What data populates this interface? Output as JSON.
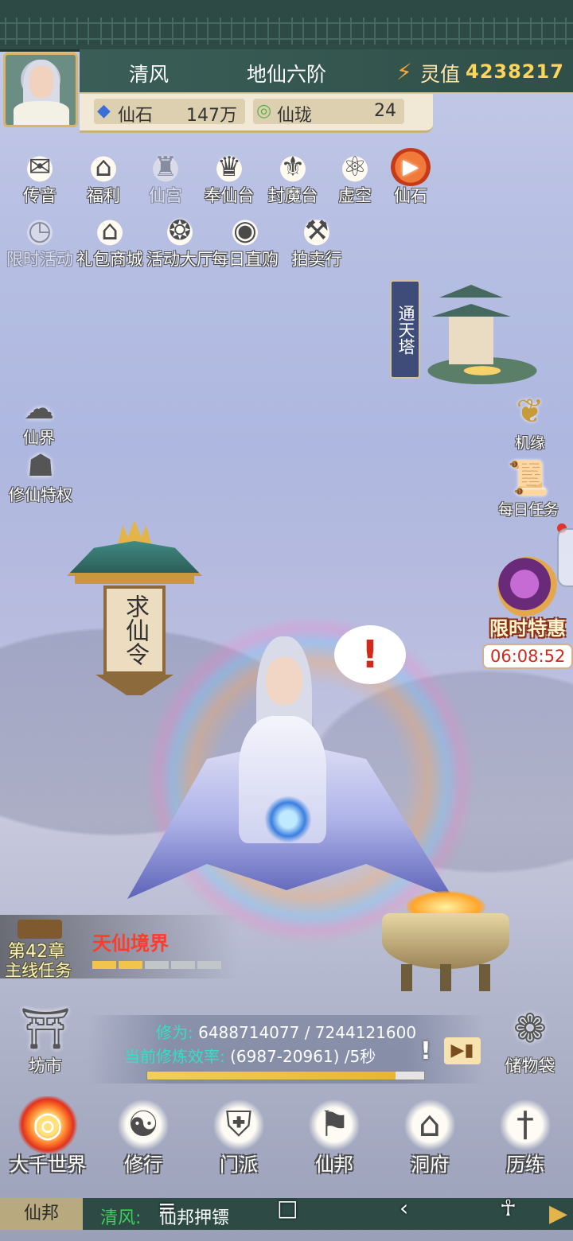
{
  "header": {
    "player_name": "清风",
    "rank": "地仙六阶",
    "power_label": "灵值",
    "power_value": "4238217",
    "currencies": [
      {
        "icon": "gem-icon",
        "label": "仙石",
        "value": "147万"
      },
      {
        "icon": "jade-ring-icon",
        "label": "仙珑",
        "value": "24"
      }
    ]
  },
  "top_icons": [
    {
      "label": "传音",
      "icon": "envelope-icon",
      "enabled": true
    },
    {
      "label": "福利",
      "icon": "gift-box-icon",
      "enabled": true
    },
    {
      "label": "仙宫",
      "icon": "palace-icon",
      "enabled": false
    },
    {
      "label": "奉仙台",
      "icon": "altar-icon",
      "enabled": true
    },
    {
      "label": "封魔台",
      "icon": "seal-icon",
      "enabled": true
    },
    {
      "label": "虚空",
      "icon": "atom-icon",
      "enabled": true
    },
    {
      "label": "仙石",
      "icon": "play-icon",
      "enabled": true
    },
    {
      "label": "限时活动",
      "icon": "timer-icon",
      "enabled": false
    },
    {
      "label": "礼包商城",
      "icon": "shop-icon",
      "enabled": true
    },
    {
      "label": "活动大厅",
      "icon": "hall-icon",
      "enabled": true
    },
    {
      "label": "每日直购",
      "icon": "coin-icon",
      "enabled": true
    },
    {
      "label": "拍卖行",
      "icon": "gavel-icon",
      "enabled": true
    }
  ],
  "left_icons": [
    {
      "label": "仙界",
      "icon": "cloud-icon"
    },
    {
      "label": "修仙特权",
      "icon": "turtle-icon"
    }
  ],
  "tower": {
    "label": "通天塔"
  },
  "right_icons": [
    {
      "label": "机缘",
      "icon": "fortune-bag-icon"
    },
    {
      "label": "每日任务",
      "icon": "scroll-icon"
    }
  ],
  "limited_offer": {
    "label": "限时特惠",
    "timer": "06:08:52"
  },
  "lantern": {
    "text": "求仙令"
  },
  "quest": {
    "chapter": "第42章",
    "type": "主线任务",
    "realm": "天仙境界",
    "progress_segments": [
      1,
      1,
      0,
      0,
      0
    ]
  },
  "cultivation": {
    "label_xiuwei": "修为:",
    "xiuwei": "6488714077 / 7244121600",
    "label_rate": "当前修炼效率:",
    "rate": "(6987-20961) /5秒",
    "progress": 0.8957,
    "left_button": "坊市",
    "right_button": "储物袋"
  },
  "nav": [
    {
      "label": "大千世界",
      "icon": "vortex-icon",
      "active": true
    },
    {
      "label": "修行",
      "icon": "yin-yang-icon",
      "active": false
    },
    {
      "label": "门派",
      "icon": "shield-icon",
      "active": false
    },
    {
      "label": "仙邦",
      "icon": "banner-icon",
      "active": false
    },
    {
      "label": "洞府",
      "icon": "pavilion-icon",
      "active": false
    },
    {
      "label": "历练",
      "icon": "sword-icon",
      "active": false
    }
  ],
  "chat": {
    "channel": "仙邦",
    "sender": "清风:",
    "message": "仙邦押镖"
  },
  "system_nav": {
    "menu": "≡",
    "home": "□",
    "back": "‹",
    "accessibility": "☥"
  }
}
